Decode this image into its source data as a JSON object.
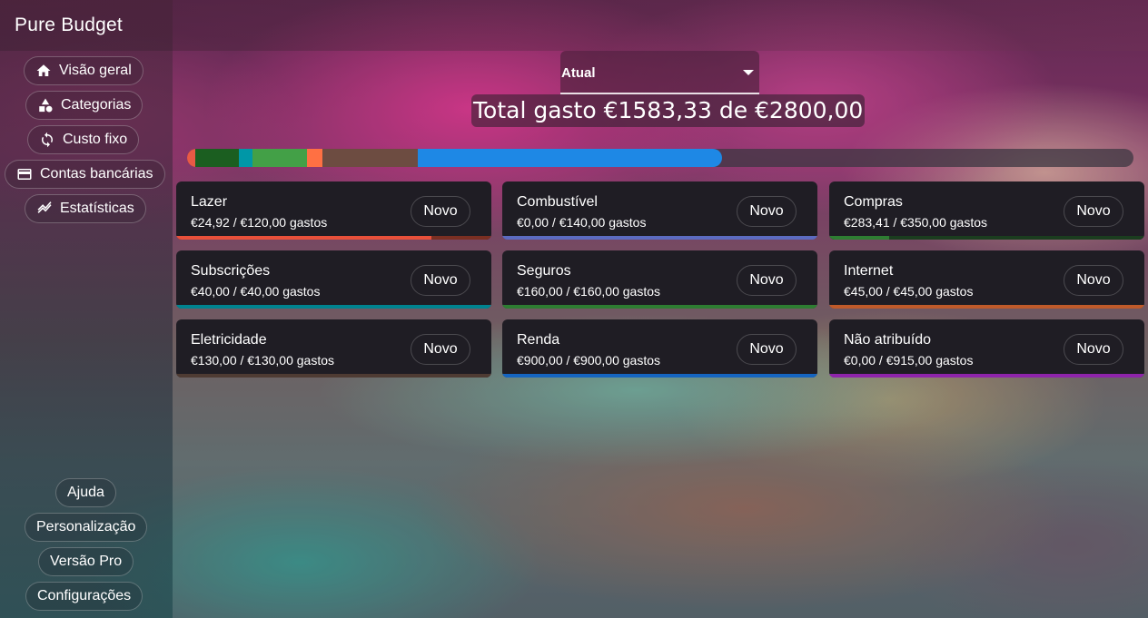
{
  "app": {
    "title": "Pure Budget"
  },
  "nav": {
    "items": [
      {
        "label": "Visão geral",
        "icon": "home-icon"
      },
      {
        "label": "Categorias",
        "icon": "shapes-icon"
      },
      {
        "label": "Custo fixo",
        "icon": "repeat-icon"
      },
      {
        "label": "Contas bancárias",
        "icon": "wallet-icon"
      },
      {
        "label": "Estatísticas",
        "icon": "chart-icon"
      }
    ],
    "bottom": [
      "Ajuda",
      "Personalização",
      "Versão Pro",
      "Configurações"
    ]
  },
  "header": {
    "period": "Atual",
    "total_text": "Total gasto €1583,33 de €2800,00"
  },
  "budget_bar": {
    "total": 2800.0,
    "segments": [
      {
        "category": "Lazer",
        "value": 24.92,
        "color": "#e85a45"
      },
      {
        "category": "Eletricidade",
        "value": 130.0,
        "color": "#1b5e20"
      },
      {
        "category": "Subscrições",
        "value": 40.0,
        "color": "#0097a7"
      },
      {
        "category": "Seguros",
        "value": 160.0,
        "color": "#43a047"
      },
      {
        "category": "Internet",
        "value": 45.0,
        "color": "#ff7043"
      },
      {
        "category": "Compras",
        "value": 283.41,
        "color": "#6d4c41"
      },
      {
        "category": "Renda",
        "value": 900.0,
        "color": "#1e88e5"
      }
    ]
  },
  "cards": [
    {
      "name": "Lazer",
      "amount": "€24,92 / €120,00 gastos",
      "button": "Novo",
      "fraction": 0.81,
      "color": "#e8503a",
      "track": "#7a2f22"
    },
    {
      "name": "Combustível",
      "amount": "€0,00 / €140,00 gastos",
      "button": "Novo",
      "fraction": 1.0,
      "color": "#5c6bc0",
      "track": "#5c6bc0"
    },
    {
      "name": "Compras",
      "amount": "€283,41 / €350,00 gastos",
      "button": "Novo",
      "fraction": 0.19,
      "color": "#2e7d32",
      "track": "#1b3d1f"
    },
    {
      "name": "Subscrições",
      "amount": "€40,00 / €40,00 gastos",
      "button": "Novo",
      "fraction": 1.0,
      "color": "#00838f",
      "track": "#00838f"
    },
    {
      "name": "Seguros",
      "amount": "€160,00 / €160,00 gastos",
      "button": "Novo",
      "fraction": 1.0,
      "color": "#2e7d32",
      "track": "#2e7d32"
    },
    {
      "name": "Internet",
      "amount": "€45,00 / €45,00 gastos",
      "button": "Novo",
      "fraction": 1.0,
      "color": "#bf5a2a",
      "track": "#bf5a2a"
    },
    {
      "name": "Eletricidade",
      "amount": "€130,00 / €130,00 gastos",
      "button": "Novo",
      "fraction": 1.0,
      "color": "#4e3b33",
      "track": "#4e3b33"
    },
    {
      "name": "Renda",
      "amount": "€900,00 / €900,00 gastos",
      "button": "Novo",
      "fraction": 1.0,
      "color": "#1565c0",
      "track": "#1565c0"
    },
    {
      "name": "Não atribuído",
      "amount": "€0,00 / €915,00 gastos",
      "button": "Novo",
      "fraction": 1.0,
      "color": "#8e24aa",
      "track": "#8e24aa"
    }
  ]
}
